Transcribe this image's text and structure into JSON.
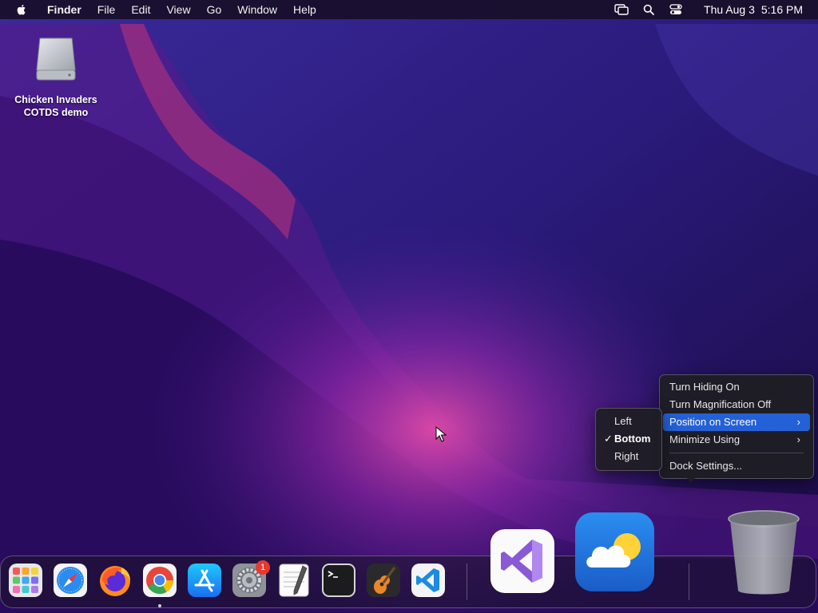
{
  "menubar": {
    "app_name": "Finder",
    "items": [
      "File",
      "Edit",
      "View",
      "Go",
      "Window",
      "Help"
    ],
    "status_icons": [
      "screen-mirroring-icon",
      "spotlight-search-icon",
      "control-center-icon"
    ],
    "date": "Thu Aug 3",
    "time": "5:16 PM"
  },
  "desktop": {
    "icon_label_line1": "Chicken Invaders",
    "icon_label_line2": "COTDS demo"
  },
  "context_menu": {
    "items": [
      {
        "label": "Turn Hiding On"
      },
      {
        "label": "Turn Magnification Off"
      },
      {
        "label": "Position on Screen",
        "submenu": true,
        "highlighted": true
      },
      {
        "label": "Minimize Using",
        "submenu": true
      },
      {
        "label": "Dock Settings..."
      }
    ],
    "submenu": {
      "items": [
        {
          "label": "Left"
        },
        {
          "label": "Bottom",
          "checked": true
        },
        {
          "label": "Right"
        }
      ],
      "check_glyph": "✓"
    },
    "chevron_glyph": "›"
  },
  "dock": {
    "apps": [
      "launchpad-icon",
      "safari-icon",
      "firefox-icon",
      "chrome-icon",
      "app-store-icon",
      "system-settings-icon",
      "textedit-icon",
      "terminal-icon",
      "garageband-icon",
      "vscode-icon",
      "visual-studio-icon",
      "weather-icon",
      "trash-icon"
    ],
    "settings_badge": "1",
    "running_app": "chrome-icon"
  },
  "colors": {
    "highlight": "#2461d6",
    "badge": "#e53a30"
  }
}
